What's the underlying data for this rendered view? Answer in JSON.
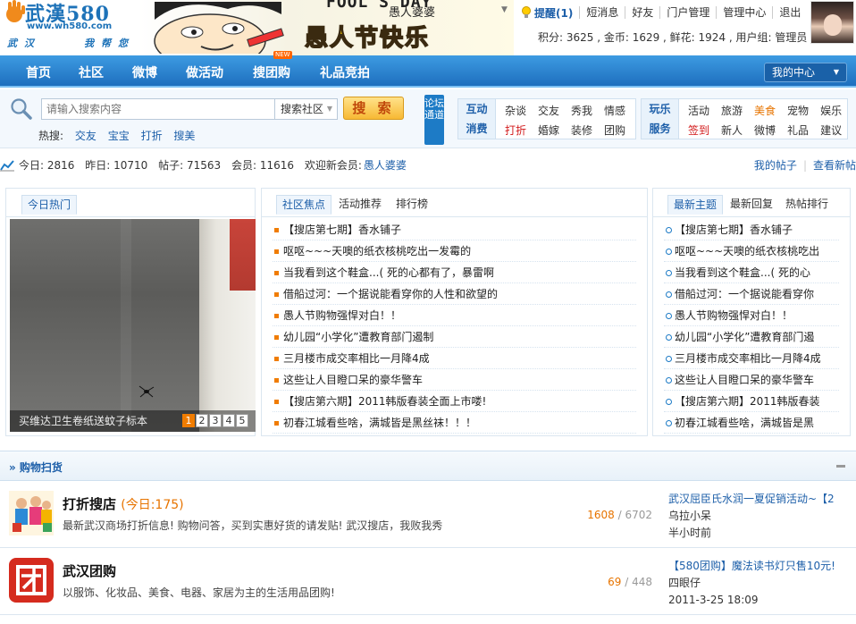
{
  "header": {
    "logo_main": "武漢580",
    "logo_url": "www.wh580.com",
    "logo_tag_left": "武汉",
    "logo_tag_right": "我帮您",
    "banner_text_top": "FOOL'S DAY",
    "banner_festival": "愚人节快乐",
    "username": "愚人婆婆",
    "top_links": [
      "提醒(1)",
      "短消息",
      "好友",
      "门户管理",
      "管理中心",
      "退出"
    ],
    "stats_line": "积分: 3625 , 金币: 1629 , 鲜花: 1924 , 用户组: 管理员"
  },
  "mainnav": {
    "items": [
      "首页",
      "社区",
      "微博",
      "做活动",
      "搜团购",
      "礼品竞拍"
    ],
    "new_badge": "NEW",
    "my_center": "我的中心"
  },
  "search": {
    "placeholder": "请输入搜索内容",
    "scope": "搜索社区",
    "button": "搜 索",
    "hot_label": "热搜:",
    "hot_links": [
      "交友",
      "宝宝",
      "打折",
      "搜美"
    ],
    "forum_channel": "论坛通道"
  },
  "categories": {
    "box1": {
      "labels": [
        "互动",
        "消费"
      ],
      "row1": [
        "杂谈",
        "交友",
        "秀我",
        "情感"
      ],
      "row2": [
        "打折",
        "婚嫁",
        "装修",
        "团购"
      ]
    },
    "box2": {
      "labels": [
        "玩乐",
        "服务"
      ],
      "row1": [
        "活动",
        "旅游",
        "美食",
        "宠物",
        "娱乐"
      ],
      "row2": [
        "签到",
        "新人",
        "微博",
        "礼品",
        "建议"
      ]
    }
  },
  "statsbar": {
    "today": "今日: 2816",
    "yesterday": "昨日: 10710",
    "posts": "帖子: 71563",
    "members": "会员: 11616",
    "welcome": "欢迎新会员:",
    "new_member": "愚人婆婆",
    "my_posts": "我的帖子",
    "view_new": "查看新帖"
  },
  "hot_today": {
    "tab": "今日热门",
    "caption": "买维达卫生卷纸送蚊子标本",
    "pages": [
      "1",
      "2",
      "3",
      "4",
      "5"
    ]
  },
  "focus": {
    "tabs": [
      "社区焦点",
      "活动推荐",
      "排行榜"
    ],
    "items": [
      "【搜店第七期】香水铺子",
      "呕呕~~~天噢的纸衣核桃吃出一发霉的",
      "当我看到这个鞋盒...( 死的心都有了，暴雷啊",
      "借船过河：一个据说能看穿你的人性和欲望的",
      "愚人节购物强悍对白！！",
      "幼儿园“小学化”遭教育部门遏制",
      "三月楼市成交率相比一月降4成",
      "这些让人目瞪口呆的豪华警车",
      "【搜店第六期】2011韩版春装全面上市喽!",
      "初春江城看些啥，满城皆是黑丝袜！！！"
    ]
  },
  "latest": {
    "tabs": [
      "最新主题",
      "最新回复",
      "热帖排行"
    ],
    "items": [
      "【搜店第七期】香水铺子",
      "呕呕~~~天噢的纸衣核桃吃出",
      "当我看到这个鞋盒...( 死的心",
      "借船过河：一个据说能看穿你",
      "愚人节购物强悍对白！！",
      "幼儿园“小学化”遭教育部门遏",
      "三月楼市成交率相比一月降4成",
      "这些让人目瞪口呆的豪华警车",
      "【搜店第六期】2011韩版春装",
      "初春江城看些啥，满城皆是黑"
    ]
  },
  "shopping": {
    "title": "» 购物扫货",
    "forums": [
      {
        "name": "打折搜店",
        "today": "(今日:175)",
        "desc": "最新武汉商场打折信息! 购物问答，买到实惠好货的请发贴! 武汉搜店，我败我秀",
        "threads": "1608",
        "posts": "6702",
        "last_title": "武汉屈臣氏水润一夏促销活动~【2",
        "last_user": "乌拉小呆",
        "last_time": "半小时前"
      },
      {
        "name": "武汉团购",
        "today": "",
        "desc": "以服饰、化妆品、美食、电器、家居为主的生活用品团购!",
        "threads": "69",
        "posts": "448",
        "last_title": "【580团购】魔法读书灯只售10元!",
        "last_user": "四眼仔",
        "last_time": "2011-3-25 18:09"
      }
    ]
  },
  "colors": {
    "nav_blue": "#1e6fbe",
    "link_blue": "#1d5fa9",
    "accent_orange": "#f07c00",
    "accent_red": "#d2191a"
  }
}
